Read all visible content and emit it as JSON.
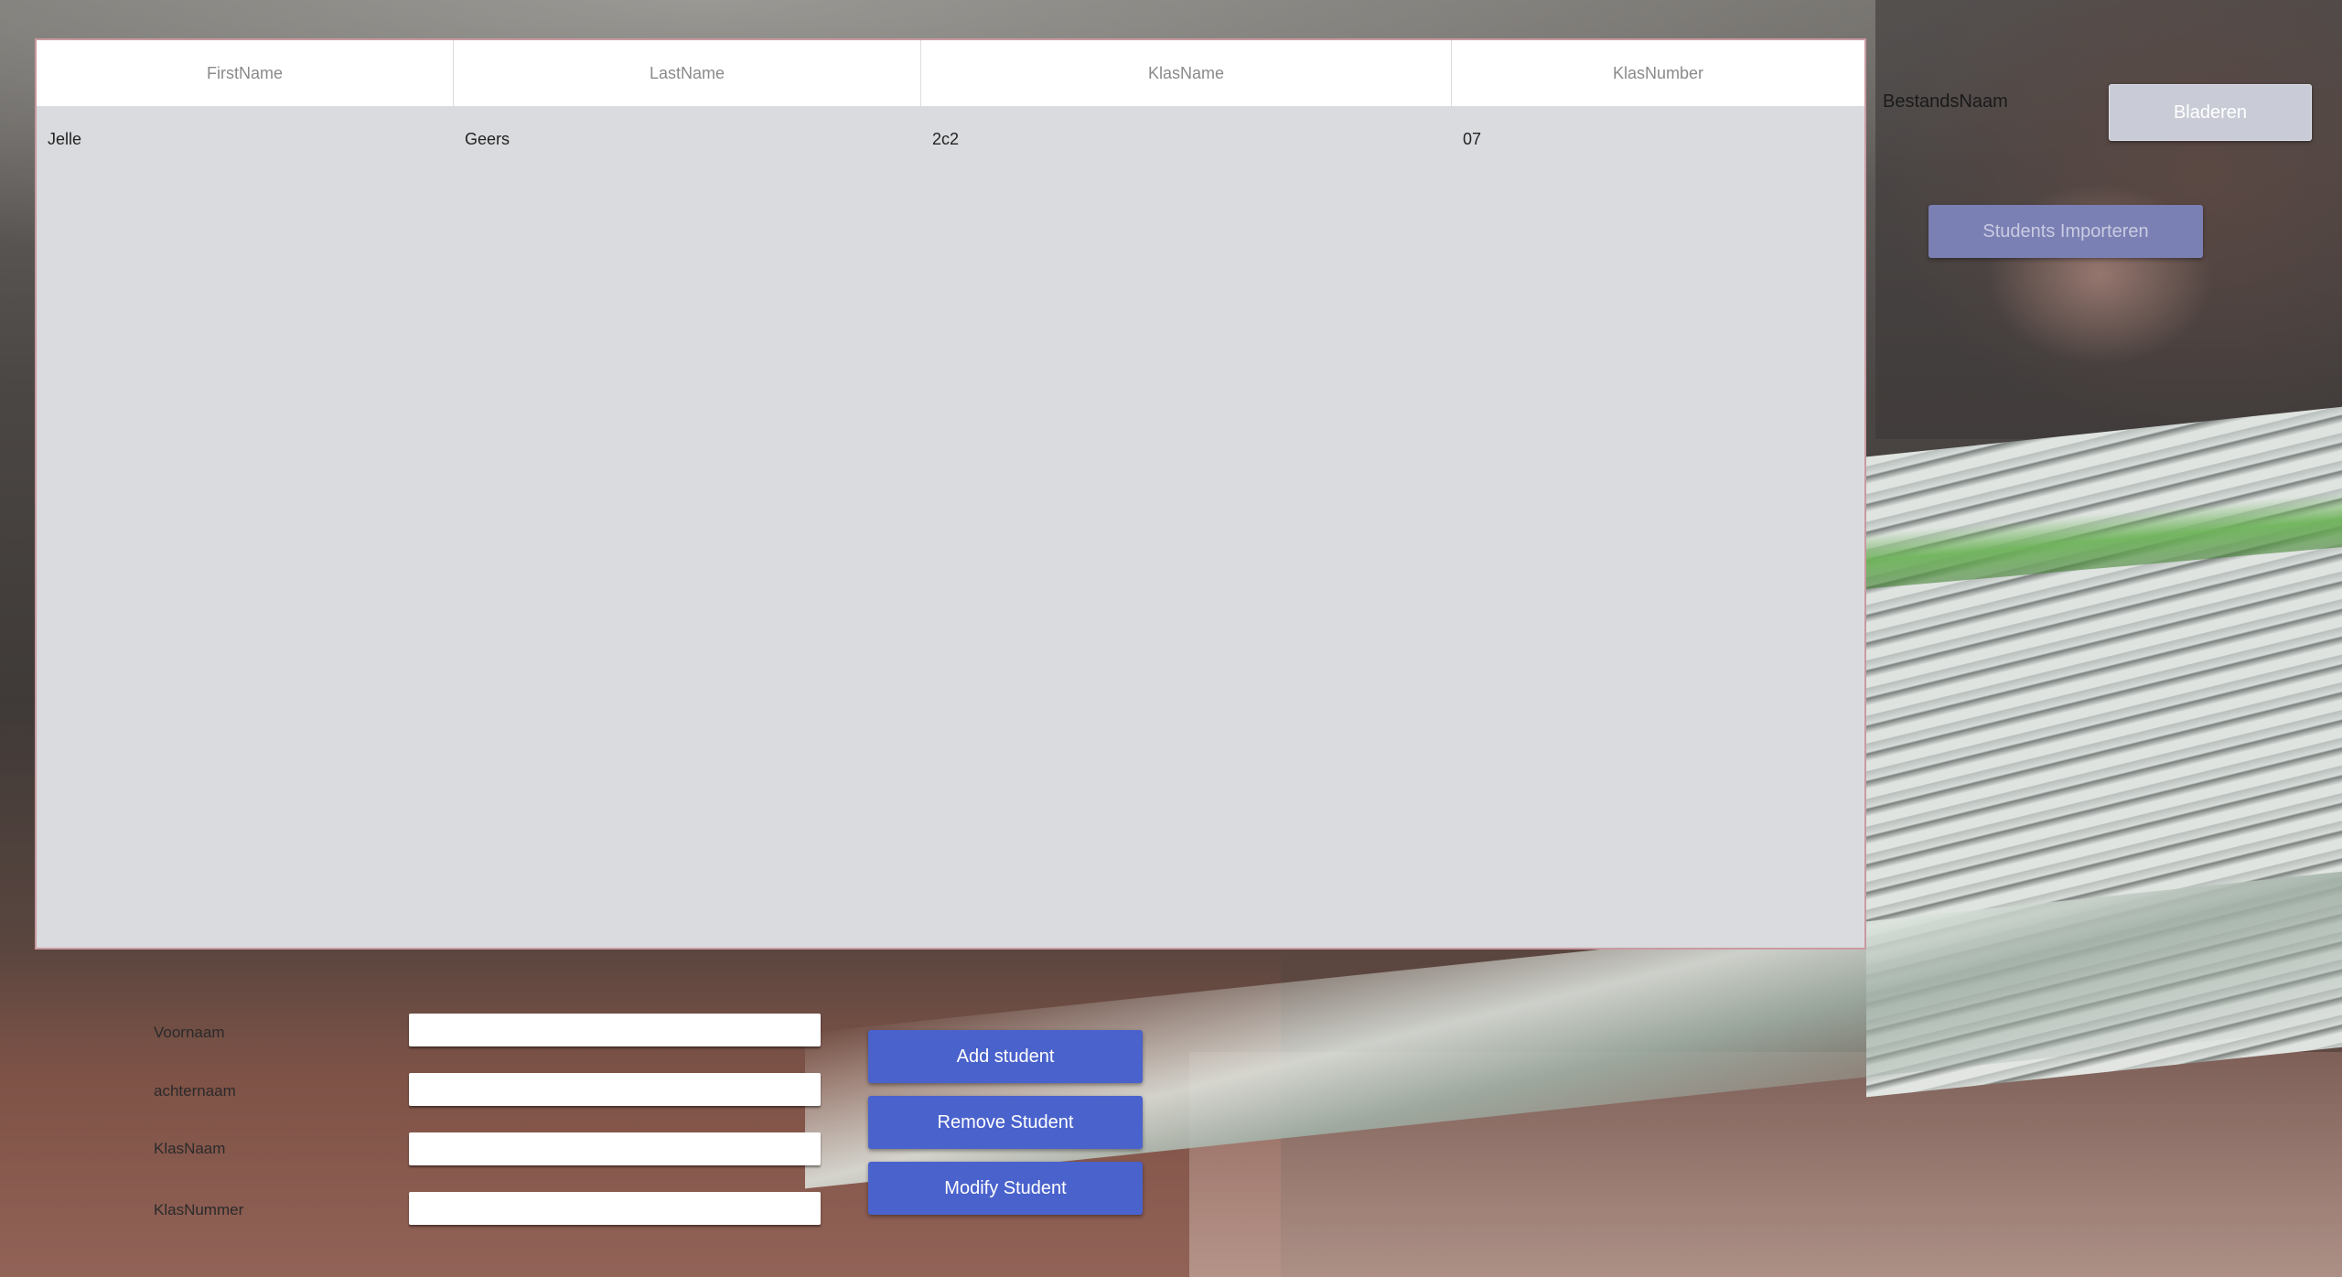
{
  "table": {
    "columns": [
      "FirstName",
      "LastName",
      "KlasName",
      "KlasNumber"
    ],
    "rows": [
      [
        "Jelle",
        "Geers",
        "2c2",
        "07"
      ]
    ]
  },
  "import": {
    "file_label": "BestandsNaam",
    "browse_label": "Bladeren",
    "import_label": "Students Importeren"
  },
  "form": {
    "first_name_label": "Voornaam",
    "last_name_label": "achternaam",
    "class_name_label": "KlasNaam",
    "class_number_label": "KlasNummer",
    "first_name_value": "",
    "last_name_value": "",
    "class_name_value": "",
    "class_number_value": ""
  },
  "actions": {
    "add_label": "Add student",
    "remove_label": "Remove Student",
    "modify_label": "Modify Student"
  },
  "colors": {
    "primary_button": "#4a62cc",
    "import_button": "#7b80b4",
    "browse_button": "#c9ccd6",
    "table_background": "#d9dbde"
  }
}
